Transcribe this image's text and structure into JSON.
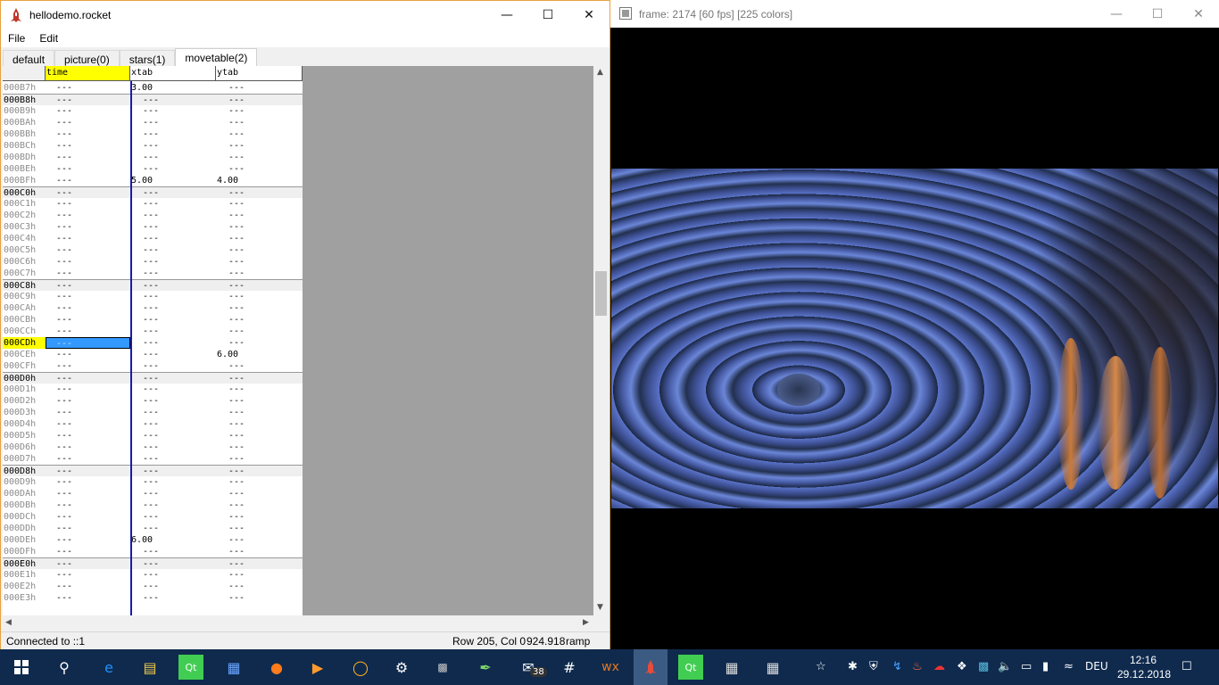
{
  "rocket": {
    "title": "hellodemo.rocket",
    "menu": [
      "File",
      "Edit"
    ],
    "tabs": [
      "default",
      "picture(0)",
      "stars(1)",
      "movetable(2)"
    ],
    "columns": [
      "time",
      "xtab",
      "ytab"
    ],
    "rows": [
      {
        "label": "000B7h",
        "time": "---",
        "xtab": "3.00",
        "ytab": "---"
      },
      {
        "label": "000B8h",
        "time": "---",
        "xtab": "---",
        "ytab": "---",
        "beat": true
      },
      {
        "label": "000B9h",
        "time": "---",
        "xtab": "---",
        "ytab": "---"
      },
      {
        "label": "000BAh",
        "time": "---",
        "xtab": "---",
        "ytab": "---"
      },
      {
        "label": "000BBh",
        "time": "---",
        "xtab": "---",
        "ytab": "---"
      },
      {
        "label": "000BCh",
        "time": "---",
        "xtab": "---",
        "ytab": "---"
      },
      {
        "label": "000BDh",
        "time": "---",
        "xtab": "---",
        "ytab": "---"
      },
      {
        "label": "000BEh",
        "time": "---",
        "xtab": "---",
        "ytab": "---"
      },
      {
        "label": "000BFh",
        "time": "---",
        "xtab": "5.00",
        "ytab": "4.00"
      },
      {
        "label": "000C0h",
        "time": "---",
        "xtab": "---",
        "ytab": "---",
        "beat": true
      },
      {
        "label": "000C1h",
        "time": "---",
        "xtab": "---",
        "ytab": "---"
      },
      {
        "label": "000C2h",
        "time": "---",
        "xtab": "---",
        "ytab": "---"
      },
      {
        "label": "000C3h",
        "time": "---",
        "xtab": "---",
        "ytab": "---"
      },
      {
        "label": "000C4h",
        "time": "---",
        "xtab": "---",
        "ytab": "---"
      },
      {
        "label": "000C5h",
        "time": "---",
        "xtab": "---",
        "ytab": "---"
      },
      {
        "label": "000C6h",
        "time": "---",
        "xtab": "---",
        "ytab": "---"
      },
      {
        "label": "000C7h",
        "time": "---",
        "xtab": "---",
        "ytab": "---"
      },
      {
        "label": "000C8h",
        "time": "---",
        "xtab": "---",
        "ytab": "---",
        "beat": true
      },
      {
        "label": "000C9h",
        "time": "---",
        "xtab": "---",
        "ytab": "---"
      },
      {
        "label": "000CAh",
        "time": "---",
        "xtab": "---",
        "ytab": "---"
      },
      {
        "label": "000CBh",
        "time": "---",
        "xtab": "---",
        "ytab": "---"
      },
      {
        "label": "000CCh",
        "time": "---",
        "xtab": "---",
        "ytab": "---"
      },
      {
        "label": "000CDh",
        "time": "---",
        "xtab": "---",
        "ytab": "---",
        "selected": true
      },
      {
        "label": "000CEh",
        "time": "---",
        "xtab": "---",
        "ytab": "6.00"
      },
      {
        "label": "000CFh",
        "time": "---",
        "xtab": "---",
        "ytab": "---"
      },
      {
        "label": "000D0h",
        "time": "---",
        "xtab": "---",
        "ytab": "---",
        "beat": true
      },
      {
        "label": "000D1h",
        "time": "---",
        "xtab": "---",
        "ytab": "---"
      },
      {
        "label": "000D2h",
        "time": "---",
        "xtab": "---",
        "ytab": "---"
      },
      {
        "label": "000D3h",
        "time": "---",
        "xtab": "---",
        "ytab": "---"
      },
      {
        "label": "000D4h",
        "time": "---",
        "xtab": "---",
        "ytab": "---"
      },
      {
        "label": "000D5h",
        "time": "---",
        "xtab": "---",
        "ytab": "---"
      },
      {
        "label": "000D6h",
        "time": "---",
        "xtab": "---",
        "ytab": "---"
      },
      {
        "label": "000D7h",
        "time": "---",
        "xtab": "---",
        "ytab": "---"
      },
      {
        "label": "000D8h",
        "time": "---",
        "xtab": "---",
        "ytab": "---",
        "beat": true
      },
      {
        "label": "000D9h",
        "time": "---",
        "xtab": "---",
        "ytab": "---"
      },
      {
        "label": "000DAh",
        "time": "---",
        "xtab": "---",
        "ytab": "---"
      },
      {
        "label": "000DBh",
        "time": "---",
        "xtab": "---",
        "ytab": "---"
      },
      {
        "label": "000DCh",
        "time": "---",
        "xtab": "---",
        "ytab": "---"
      },
      {
        "label": "000DDh",
        "time": "---",
        "xtab": "---",
        "ytab": "---"
      },
      {
        "label": "000DEh",
        "time": "---",
        "xtab": "6.00",
        "ytab": "---"
      },
      {
        "label": "000DFh",
        "time": "---",
        "xtab": "---",
        "ytab": "---"
      },
      {
        "label": "000E0h",
        "time": "---",
        "xtab": "---",
        "ytab": "---",
        "beat": true
      },
      {
        "label": "000E1h",
        "time": "---",
        "xtab": "---",
        "ytab": "---"
      },
      {
        "label": "000E2h",
        "time": "---",
        "xtab": "---",
        "ytab": "---"
      },
      {
        "label": "000E3h",
        "time": "---",
        "xtab": "---",
        "ytab": "---"
      }
    ],
    "status": {
      "connection": "Connected to ::1",
      "position": "Row 205, Col 0",
      "value": "924.918",
      "interpolation": "ramp"
    }
  },
  "frame": {
    "title": "frame: 2174 [60 fps] [225 colors]"
  },
  "taskbar": {
    "badge": "38",
    "language": "DEU",
    "time": "12:16",
    "date": "29.12.2018"
  },
  "colors": {
    "time_header": "#ffff00",
    "selection": "#3399ff",
    "cursor_line": "#1a1ab0",
    "window_accent": "#e8a33e",
    "taskbar": "#0f2a4d"
  }
}
